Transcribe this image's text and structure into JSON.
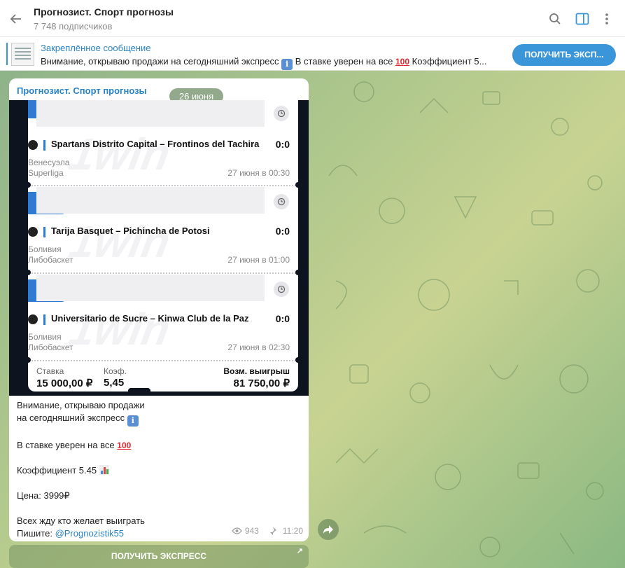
{
  "header": {
    "title": "Прогнозист. Спорт прогнозы",
    "subtitle": "7 748 подписчиков"
  },
  "pinned": {
    "title": "Закреплённое сообщение",
    "text_before": "Внимание, открываю продажи  на сегодняшний экспресс",
    "text_mid": "  В ставке уверен на все",
    "text_after": "  Коэффициент 5...",
    "button": "ПОЛУЧИТЬ ЭКСП..."
  },
  "message": {
    "author": "Прогнозист. Спорт прогнозы",
    "date_pill": "26 июня",
    "watermark": "1win",
    "bets": [
      {
        "match": "Spartans Distrito Capital – Frontinos del Tachira",
        "score": "0:0",
        "country": "Венесуэла",
        "league": "Superliga",
        "datetime": "27 июня в 00:30"
      },
      {
        "match": "Tarija Basquet – Pichincha de Potosi",
        "score": "0:0",
        "country": "Боливия",
        "league": "Либобаскет",
        "datetime": "27 июня в 01:00"
      },
      {
        "match": "Universitario de Sucre – Kinwa Club de la Paz",
        "score": "0:0",
        "country": "Боливия",
        "league": "Либобаскет",
        "datetime": "27 июня в 02:30"
      }
    ],
    "footer": {
      "stake_label": "Ставка",
      "stake_value": "15 000,00 ₽",
      "coef_label": "Коэф.",
      "coef_value": "5,45",
      "win_label": "Возм. выигрыш",
      "win_value": "81 750,00 ₽"
    },
    "text": {
      "line1": "Внимание, открываю продажи",
      "line2": "на сегодняшний экспресс",
      "line3": "В ставке уверен на все",
      "line4": "Коэффициент 5.45",
      "line5": "Цена: 3999₽",
      "line6": "Всех жду кто желает выиграть",
      "line7_prefix": "Пишите: ",
      "line7_link": "@Prognozistik55"
    },
    "views": "943",
    "time": "11:20",
    "inline_button": "ПОЛУЧИТЬ ЭКСПРЕСС"
  },
  "icons": {
    "back": "arrow-left-icon",
    "search": "search-icon",
    "sidebar": "sidebar-toggle-icon",
    "more": "more-vertical-icon",
    "info_emoji": "information-emoji",
    "hundred_emoji": "hundred-points-emoji",
    "chart_emoji": "bar-chart-emoji",
    "views": "eye-icon",
    "pinned": "pin-icon",
    "forward": "forward-icon",
    "clock": "clock-icon",
    "basketball": "basketball-icon",
    "link": "external-link-icon"
  },
  "colors": {
    "accent": "#3a95d9",
    "link": "#2a83c6",
    "ticket_blue": "#2f7bd1"
  }
}
